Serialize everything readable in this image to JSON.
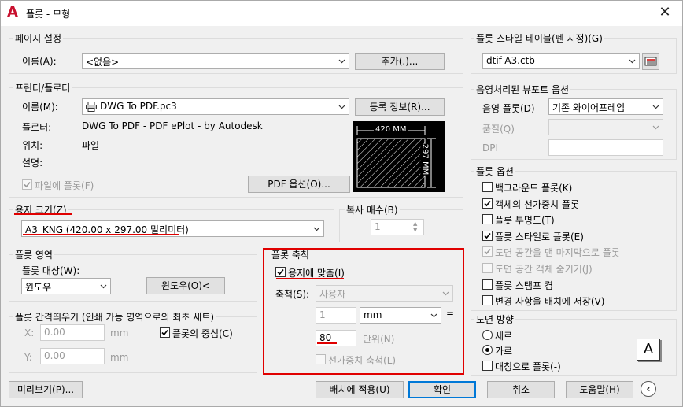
{
  "window": {
    "title": "플롯 - 모형",
    "app_icon": "A"
  },
  "page_setup": {
    "group_label": "페이지 설정",
    "name_label": "이름(A):",
    "name_value": "<없음>",
    "add_button": "추가(.)..."
  },
  "printer": {
    "group_label": "프린터/플로터",
    "name_label": "이름(M):",
    "name_value": "DWG To PDF.pc3",
    "properties_button": "등록 정보(R)...",
    "plotter_label": "플로터:",
    "plotter_value": "DWG To PDF - PDF ePlot - by Autodesk",
    "location_label": "위치:",
    "location_value": "파일",
    "description_label": "설명:",
    "plot_to_file_label": "파일에 플롯(F)",
    "pdf_options_button": "PDF 옵션(O)...",
    "preview_width": "420 MM",
    "preview_height": "297 MM"
  },
  "paper_size": {
    "group_label": "용지 크기(Z)",
    "value": "A3_KNG (420.00 x 297.00 밀리미터)"
  },
  "copies": {
    "group_label": "복사 매수(B)",
    "value": "1"
  },
  "plot_area": {
    "group_label": "플롯 영역",
    "what_label": "플롯 대상(W):",
    "what_value": "윈도우",
    "window_button": "윈도우(O)<"
  },
  "plot_offset": {
    "group_label": "플롯 간격띄우기 (인쇄 가능 영역으로의 최초 세트)",
    "x_label": "X:",
    "x_value": "0.00",
    "x_unit": "mm",
    "y_label": "Y:",
    "y_value": "0.00",
    "y_unit": "mm",
    "center_label": "플롯의 중심(C)"
  },
  "plot_scale": {
    "group_label": "플롯 축척",
    "fit_label": "용지에 맞춤(I)",
    "scale_label": "축척(S):",
    "scale_value": "사용자",
    "value1": "1",
    "unit1": "mm",
    "equals": "=",
    "value2": "80",
    "unit2": "단위(N)",
    "lineweights_label": "선가중치 축척(L)"
  },
  "plot_style_table": {
    "group_label": "플롯 스타일 테이블(펜 지정)(G)",
    "value": "dtif-A3.ctb"
  },
  "shaded_viewport": {
    "group_label": "음영처리된 뷰포트 옵션",
    "shade_label": "음영 플롯(D)",
    "shade_value": "기존 와이어프레임",
    "quality_label": "품질(Q)",
    "dpi_label": "DPI"
  },
  "plot_options": {
    "group_label": "플롯 옵션",
    "items": [
      {
        "label": "백그라운드 플롯(K)",
        "checked": false,
        "enabled": true
      },
      {
        "label": "객체의 선가중치 플롯",
        "checked": true,
        "enabled": true
      },
      {
        "label": "플롯 투명도(T)",
        "checked": false,
        "enabled": true
      },
      {
        "label": "플롯 스타일로 플롯(E)",
        "checked": true,
        "enabled": true
      },
      {
        "label": "도면 공간을 맨 마지막으로 플롯",
        "checked": true,
        "enabled": false
      },
      {
        "label": "도면 공간 객체 숨기기(J)",
        "checked": false,
        "enabled": false
      },
      {
        "label": "플롯 스탬프 켬",
        "checked": false,
        "enabled": true
      },
      {
        "label": "변경 사항을 배치에 저장(V)",
        "checked": false,
        "enabled": true
      }
    ]
  },
  "orientation": {
    "group_label": "도면 방향",
    "portrait_label": "세로",
    "landscape_label": "가로",
    "upside_down_label": "대칭으로 플롯(-)",
    "icon_letter": "A"
  },
  "footer": {
    "preview_button": "미리보기(P)...",
    "apply_button": "배치에 적용(U)",
    "ok_button": "확인",
    "cancel_button": "취소",
    "help_button": "도움말(H)"
  }
}
